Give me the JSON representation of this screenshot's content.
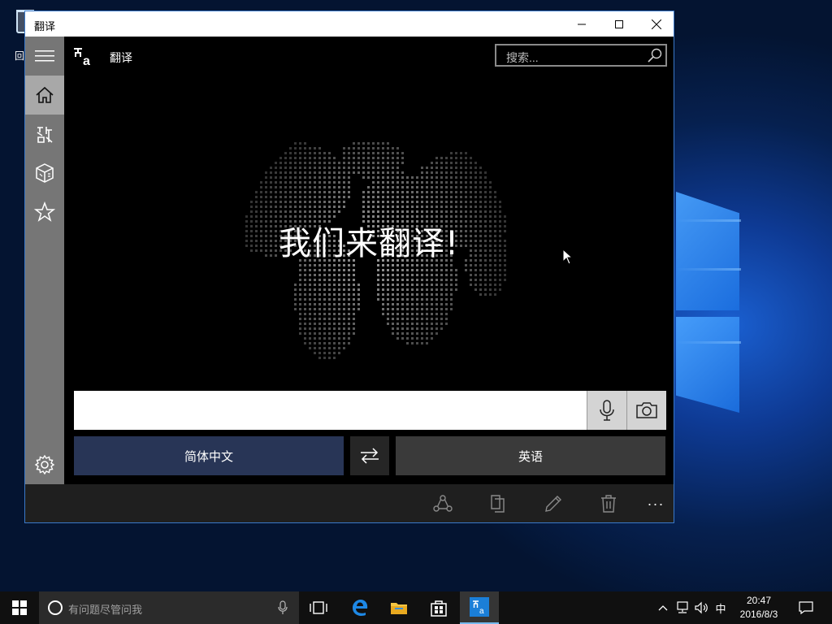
{
  "desktop": {
    "recycle_bin_label": "回",
    "accent": "#1b6fe0"
  },
  "window": {
    "title": "翻译",
    "minimize": "—",
    "maximize": "☐",
    "close": "✕",
    "border_color": "#3a79c9"
  },
  "sidebar": {
    "items": [
      {
        "name": "home",
        "icon": "home-icon"
      },
      {
        "name": "phrasebook",
        "icon": "phrasebook-icon"
      },
      {
        "name": "conversation",
        "icon": "cube-icon"
      },
      {
        "name": "favorites",
        "icon": "star-icon"
      }
    ],
    "settings_icon": "gear-icon"
  },
  "header": {
    "app_name": "翻译",
    "logo_text": "a",
    "search_placeholder": "搜索..."
  },
  "main": {
    "headline": "我们来翻译!",
    "input_value": "",
    "source_language": "简体中文",
    "target_language": "英语"
  },
  "command_bar": {
    "items": [
      "share-icon",
      "copy-icon",
      "edit-icon",
      "delete-icon"
    ],
    "more": "···"
  },
  "taskbar": {
    "search_placeholder": "有问题尽管问我",
    "ime_label": "中",
    "time": "20:47",
    "date": "2016/8/3",
    "accent": "#76b9ed"
  }
}
